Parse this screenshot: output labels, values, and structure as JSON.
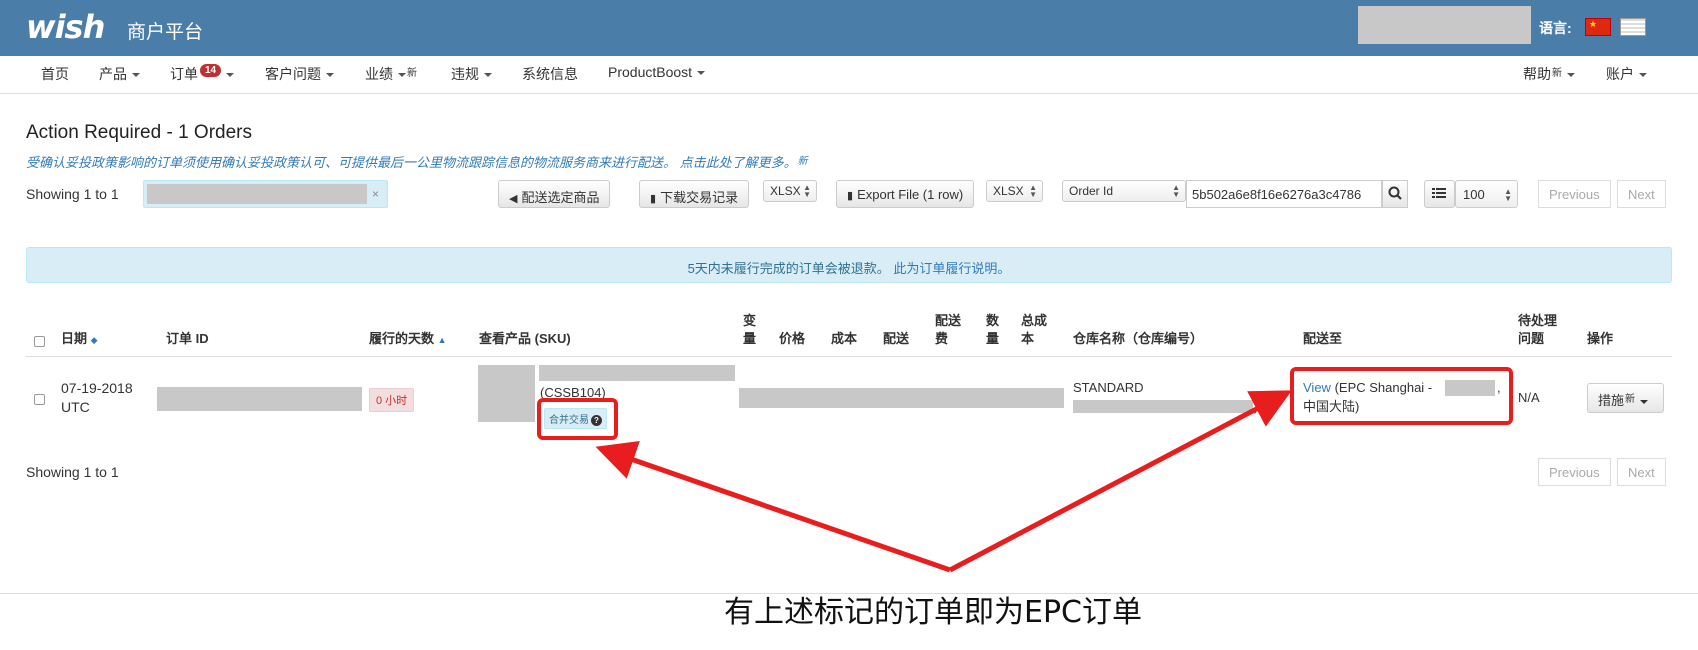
{
  "header": {
    "logo": "wish",
    "platform": "商户平台",
    "language_label": "语言:",
    "flags": [
      "china-flag-icon",
      "us-flag-icon"
    ]
  },
  "nav": {
    "items": [
      {
        "label": "首页",
        "caret": false
      },
      {
        "label": "产品",
        "caret": true
      },
      {
        "label": "订单",
        "caret": true,
        "badge": "14"
      },
      {
        "label": "客户问题",
        "caret": true
      },
      {
        "label": "业绩",
        "caret": true,
        "sup": "新"
      },
      {
        "label": "违规",
        "caret": true
      },
      {
        "label": "系统信息",
        "caret": false
      },
      {
        "label": "ProductBoost",
        "caret": true
      }
    ],
    "right": [
      {
        "label": "帮助",
        "sup": "新",
        "caret": true
      },
      {
        "label": "账户",
        "caret": true
      }
    ]
  },
  "page": {
    "title": "Action Required - 1 Orders",
    "policy_text": "受确认妥投政策影响的订单须使用确认妥投政策认可、可提供最后一公里物流跟踪信息的物流服务商来进行配送。 点击此处了解更多。",
    "policy_sup": "新",
    "showing_top": "Showing 1 to 1",
    "showing_bottom": "Showing 1 to 1",
    "clear_x": "×"
  },
  "toolbar": {
    "ship_selected": "配送选定商品",
    "download_transactions": "下载交易记录",
    "format1": "XLSX",
    "export_file": "Export File (1 row)",
    "format2": "XLSX",
    "filter_field": "Order Id",
    "search_value": "5b502a6e8f16e6276a3c4786",
    "page_size": "100",
    "previous": "Previous",
    "next": "Next"
  },
  "alert": {
    "text": "5天内未履行完成的订单会被退款。",
    "link": "此为订单履行说明。"
  },
  "table": {
    "headers": {
      "date": "日期",
      "order_id": "订单 ID",
      "days": "履行的天数",
      "product": "查看产品 (SKU)",
      "variant": [
        "变",
        "量"
      ],
      "price": "价格",
      "cost": "成本",
      "shipping": "配送",
      "ship_fee": [
        "配送",
        "费"
      ],
      "quantity": [
        "数",
        "量"
      ],
      "total_cost": [
        "总成",
        "本"
      ],
      "warehouse": "仓库名称（仓库编号）",
      "ship_to": "配送至",
      "pending": [
        "待处理",
        "问题"
      ],
      "actions": "操作"
    },
    "row": {
      "date": [
        "07-19-2018",
        "UTC"
      ],
      "days": "0 小时",
      "sku": "(CSSB104)",
      "merge_tag": "合并交易",
      "warehouse": "STANDARD",
      "warehouse_suffix": ")",
      "ship_to_link": "View",
      "ship_to_text": "(EPC Shanghai -",
      "ship_to_comma": ",",
      "ship_to_line2": "中国大陆)",
      "pending": "N/A",
      "action_label": "措施",
      "action_sup": "新"
    }
  },
  "annotation": {
    "caption": "有上述标记的订单即为EPC订单",
    "color": "#e81e1e"
  }
}
